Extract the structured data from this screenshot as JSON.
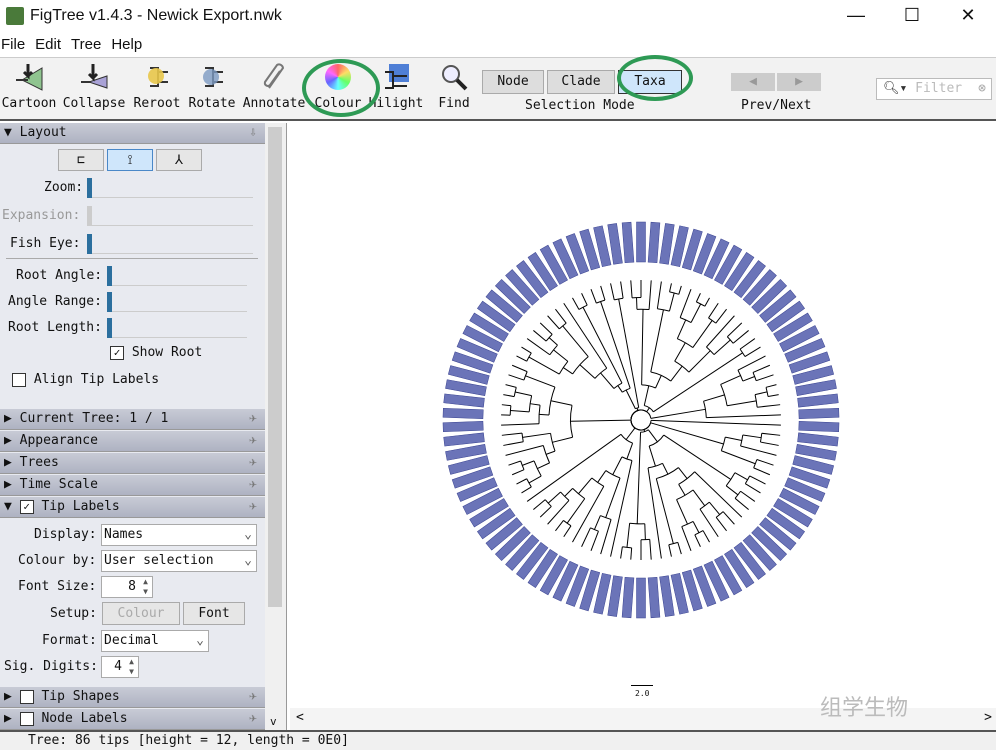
{
  "window": {
    "title": "FigTree v1.4.3 - Newick Export.nwk",
    "minimize": "—",
    "maximize": "☐",
    "close": "✕"
  },
  "menu": [
    "File",
    "Edit",
    "Tree",
    "Help"
  ],
  "toolbar": {
    "tools": [
      "Cartoon",
      "Collapse",
      "Reroot",
      "Rotate",
      "Annotate",
      "Colour",
      "Hilight",
      "Find"
    ],
    "selection_modes": [
      "Node",
      "Clade",
      "Taxa"
    ],
    "selected_mode": "Taxa",
    "selection_label": "Selection Mode",
    "prevnext_label": "Prev/Next",
    "filter_placeholder": "Filter",
    "highlight_color": "#2e9a55"
  },
  "layout": {
    "header": "Layout",
    "zoom": "Zoom:",
    "expansion": "Expansion:",
    "fish_eye": "Fish Eye:",
    "root_angle": "Root Angle:",
    "angle_range": "Angle Range:",
    "root_length": "Root Length:",
    "show_root": "Show Root",
    "show_root_checked": true,
    "align_tip_labels": "Align Tip Labels",
    "align_checked": false
  },
  "sections": {
    "current_tree": "Current Tree: 1 / 1",
    "appearance": "Appearance",
    "trees": "Trees",
    "time_scale": "Time Scale",
    "tip_labels": "Tip Labels",
    "tip_shapes": "Tip Shapes",
    "node_labels": "Node Labels"
  },
  "tip_labels": {
    "display_label": "Display:",
    "display": "Names",
    "colour_by_label": "Colour by:",
    "colour_by": "User selection",
    "font_size_label": "Font Size:",
    "font_size": "8",
    "setup_label": "Setup:",
    "colour_btn": "Colour",
    "font_btn": "Font",
    "format_label": "Format:",
    "format": "Decimal",
    "sig_digits_label": "Sig. Digits:",
    "sig_digits": "4"
  },
  "canvas": {
    "scale_label": "2.0",
    "tip_color": "#6b74b8",
    "tip_count": 86
  },
  "watermark": "组学生物",
  "status": "Tree: 86 tips [height = 12, length = 0E0]"
}
